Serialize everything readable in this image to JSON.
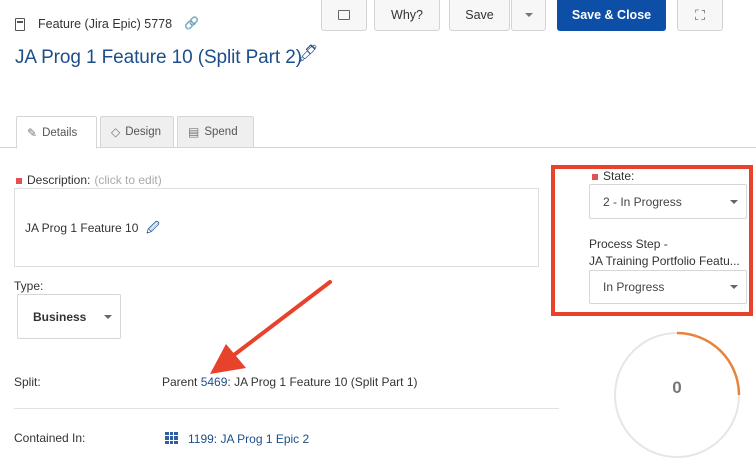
{
  "header": {
    "entity_type": "Feature (Jira Epic) 5778",
    "title": "JA Prog 1 Feature 10 (Split Part 2)"
  },
  "toolbar": {
    "why_label": "Why?",
    "save_label": "Save",
    "save_close_label": "Save & Close"
  },
  "tabs": [
    {
      "label": "Details",
      "icon": "pencil-icon"
    },
    {
      "label": "Design",
      "icon": "diamond-icon"
    },
    {
      "label": "Spend",
      "icon": "cash-icon"
    }
  ],
  "description": {
    "label": "Description:",
    "hint": "(click to edit)",
    "value": "JA Prog 1 Feature 10"
  },
  "type": {
    "label": "Type:",
    "value": "Business"
  },
  "split": {
    "label": "Split:",
    "prefix": "Parent ",
    "link_id": "5469",
    "suffix": ": JA Prog 1 Feature 10 (Split Part 1)"
  },
  "contained_in": {
    "label": "Contained In:",
    "value": "1199: JA Prog 1 Epic 2"
  },
  "state": {
    "label": "State:",
    "value": "2 - In Progress"
  },
  "process_step": {
    "label_line1": "Process Step -",
    "label_line2": "JA Training Portfolio Featu...",
    "value": "In Progress"
  },
  "gauge": {
    "value": "0",
    "accent_color": "#e8823c"
  },
  "colors": {
    "primary": "#0d4ea6",
    "link": "#1d4e89",
    "highlight": "#e8412c",
    "required": "#e05353"
  }
}
